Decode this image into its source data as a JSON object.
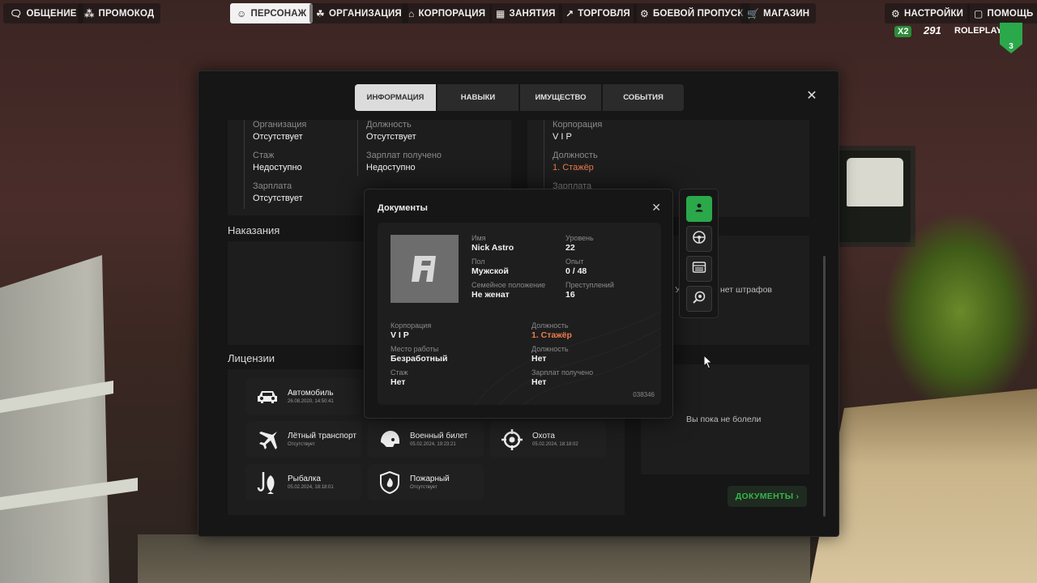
{
  "topnav": {
    "left": [
      {
        "label": "ОБЩЕНИЕ",
        "icon": "chat-icon"
      },
      {
        "label": "ПРОМОКОД",
        "icon": "gift-icon"
      }
    ],
    "center": [
      {
        "label": "ПЕРСОНАЖ",
        "icon": "user-icon",
        "active": true
      },
      {
        "label": "ОРГАНИЗАЦИЯ",
        "icon": "organization-icon"
      },
      {
        "label": "КОРПОРАЦИЯ",
        "icon": "corporation-icon"
      },
      {
        "label": "ЗАНЯТИЯ",
        "icon": "calendar-icon"
      },
      {
        "label": "ТОРГОВЛЯ",
        "icon": "chart-icon"
      },
      {
        "label": "БОЕВОЙ ПРОПУСК",
        "icon": "gear-badge-icon"
      },
      {
        "label": "МАГАЗИН",
        "icon": "cart-icon"
      }
    ],
    "right": [
      {
        "label": "НАСТРОЙКИ",
        "icon": "gear-icon"
      },
      {
        "label": "ПОМОЩЬ",
        "icon": "help-icon"
      }
    ]
  },
  "brand": {
    "multiplier": "X2",
    "server": "291",
    "name": "ROLEPLAY",
    "level": "3"
  },
  "tabs": [
    "ИНФОРМАЦИЯ",
    "НАВЫКИ",
    "ИМУЩЕСТВО",
    "СОБЫТИЯ"
  ],
  "organization": {
    "org_label": "Организация",
    "org_value": "Отсутствует",
    "position_label": "Должность",
    "position_value": "Отсутствует",
    "exp_label": "Стаж",
    "exp_value": "Недоступно",
    "salary_got_label": "Зарплат получено",
    "salary_got_value": "Недоступно",
    "salary_label": "Зарплата",
    "salary_value": "Отсутствует"
  },
  "corporation": {
    "corp_label": "Корпорация",
    "corp_value": "V I P",
    "position_label": "Должность",
    "position_value": "1. Стажёр",
    "salary_label": "Зарплата"
  },
  "sections": {
    "punishments": "Наказания",
    "fines_partial": "У",
    "no_fines": "нет штрафов",
    "licenses": "Лицензии",
    "diseases_partial": "и",
    "no_diseases": "Вы пока не болели",
    "documents_button": "ДОКУМЕНТЫ ›"
  },
  "licenses": [
    {
      "name": "Автомобиль",
      "date": "26.08.2020, 14:50:41",
      "icon": "car-icon"
    },
    {
      "name": "Лётный транспорт",
      "date": "Отсутствует",
      "icon": "plane-icon"
    },
    {
      "name": "Военный билет",
      "date": "05.02.2024, 19:23:21",
      "icon": "helmet-icon"
    },
    {
      "name": "Охота",
      "date": "05.02.2024, 18:18:02",
      "icon": "crosshair-icon"
    },
    {
      "name": "Рыбалка",
      "date": "05.02.2024, 18:18:01",
      "icon": "fish-hook-icon"
    },
    {
      "name": "Пожарный",
      "date": "Отсутствует",
      "icon": "fire-shield-icon"
    }
  ],
  "documents_modal": {
    "title": "Документы",
    "name_label": "Имя",
    "name_value": "Nick Astro",
    "level_label": "Уровень",
    "level_value": "22",
    "sex_label": "Пол",
    "sex_value": "Мужской",
    "exp_label": "Опыт",
    "exp_value": "0 / 48",
    "family_label": "Семейное положение",
    "family_value": "Не женат",
    "crimes_label": "Преступлений",
    "crimes_value": "16",
    "corp_label": "Корпорация",
    "corp_value": "V I P",
    "corp_position_label": "Должность",
    "corp_position_value": "1. Стажёр",
    "work_label": "Место работы",
    "work_value": "Безработный",
    "position_label": "Должность",
    "position_value": "Нет",
    "stage_label": "Стаж",
    "stage_value": "Нет",
    "salary_label": "Зарплат получено",
    "salary_value": "Нет",
    "doc_number": "038346"
  },
  "doc_tabs": [
    "passport-icon",
    "driving-wheel-icon",
    "card-icon",
    "search-gear-icon"
  ],
  "colors": {
    "accent": "#2aa84a",
    "orange": "#ee7b4c"
  }
}
